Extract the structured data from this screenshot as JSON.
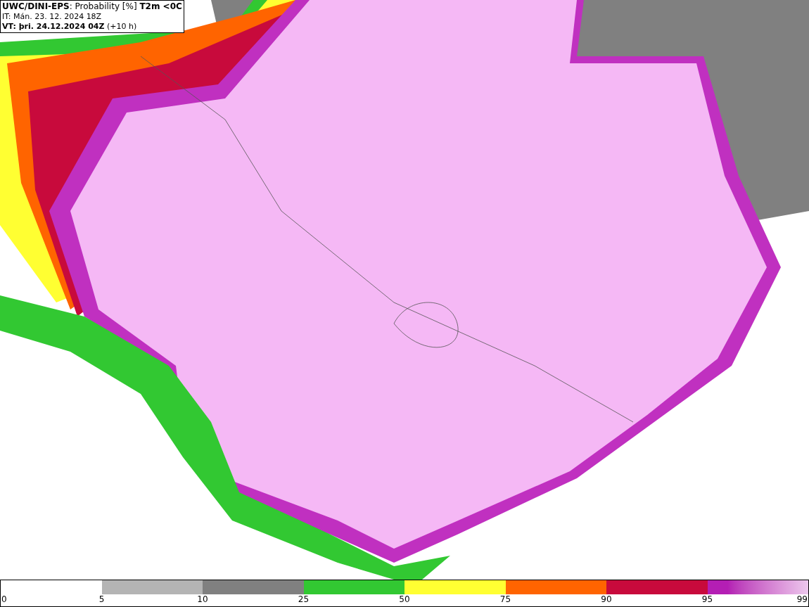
{
  "header": {
    "lines": [
      "**UWC/DINI-EPS**: Probability [%] **T2m <0C**",
      "IT: Mán. 23. 12. 2024 18Z",
      "**VT: þri. 24.12.2024 04Z** (+10 h)"
    ]
  },
  "legend": {
    "segments": [
      {
        "kind": "solid",
        "color": "#b4b4b4"
      },
      {
        "kind": "solid",
        "color": "#808080"
      },
      {
        "kind": "solid",
        "color": "#32c832"
      },
      {
        "kind": "solid",
        "color": "#ffff32"
      },
      {
        "kind": "solid",
        "color": "#ff6400"
      },
      {
        "kind": "solid",
        "color": "#c80a3c"
      },
      {
        "kind": "gradient",
        "color": "#b41eb4"
      }
    ],
    "labels": [
      "0",
      "5",
      "10",
      "25",
      "50",
      "75",
      "90",
      "95",
      "99"
    ]
  }
}
